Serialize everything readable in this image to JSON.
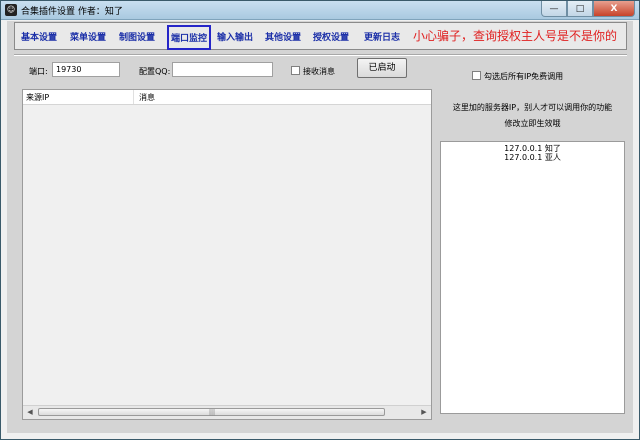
{
  "window": {
    "title": "合集插件设置  作者：知了",
    "min_label": "—",
    "max_label": "□",
    "close_label": "X"
  },
  "menu": {
    "items": [
      {
        "label": "基本设置"
      },
      {
        "label": "菜单设置"
      },
      {
        "label": "制图设置"
      },
      {
        "label": "端口监控"
      },
      {
        "label": "输入输出"
      },
      {
        "label": "其他设置"
      },
      {
        "label": "授权设置"
      },
      {
        "label": "更新日志"
      }
    ],
    "active_index": 3,
    "warning": "小心骗子，查询授权主人号是不是你的"
  },
  "controls": {
    "port_label": "端口:",
    "port_value": "19730",
    "qq_label": "配置QQ:",
    "qq_value": "",
    "receive_label": "接收消息",
    "receive_checked": false,
    "start_button": "已启动"
  },
  "listview": {
    "columns": [
      "来源IP",
      "消息"
    ]
  },
  "right_panel": {
    "free_checkbox_label": "勾选后所有IP免费调用",
    "free_checked": false,
    "note_line1": "这里加的服务器IP，别人才可以调用你的功能",
    "note_line2": "修改立即生效哦",
    "entries": [
      "127.0.0.1 知了",
      "127.0.0.1 亚人"
    ]
  },
  "colors": {
    "menu_text": "#1b2fa8",
    "warning": "#e02020",
    "active_border": "#2525c8"
  }
}
